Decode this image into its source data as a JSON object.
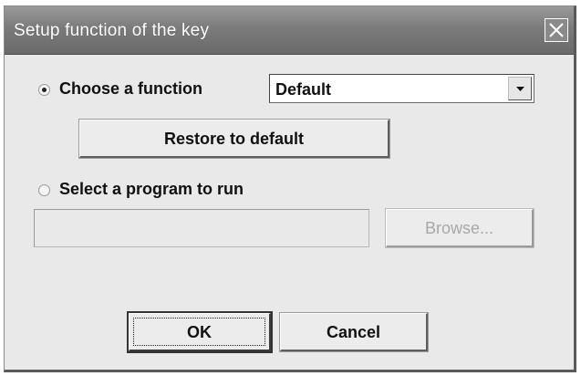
{
  "window": {
    "title": "Setup function of the key"
  },
  "function_option": {
    "label": "Choose a function",
    "selected": true
  },
  "function_select": {
    "value": "Default"
  },
  "restore_button": {
    "label": "Restore to default"
  },
  "program_option": {
    "label": "Select a program to run",
    "selected": false
  },
  "program_path": {
    "value": ""
  },
  "browse_button": {
    "label": "Browse...",
    "enabled": false
  },
  "footer": {
    "ok_label": "OK",
    "cancel_label": "Cancel"
  },
  "icons": {
    "close": "close-icon",
    "dropdown": "chevron-down-icon"
  }
}
